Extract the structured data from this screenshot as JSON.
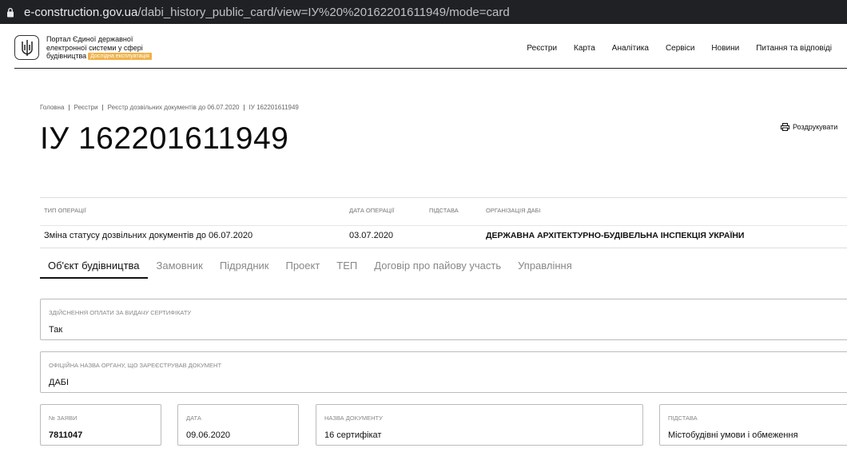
{
  "browser": {
    "url_host": "e-construction.gov.ua",
    "url_path": "/dabi_history_public_card/view=ІУ%20%20162201611949/mode=card"
  },
  "header": {
    "portal_line1": "Портал Єдиної державної",
    "portal_line2": "електронної системи у сфері",
    "portal_line3": "будівництва",
    "badge": "Дослідна експлуатація",
    "nav": [
      "Реєстри",
      "Карта",
      "Аналітика",
      "Сервіси",
      "Новини",
      "Питання та відповіді"
    ]
  },
  "breadcrumb": [
    "Головна",
    "Реєстри",
    "Реєстр дозвільних документів до 06.07.2020",
    "ІУ 162201611949"
  ],
  "title": "ІУ 162201611949",
  "print_label": "Роздрукувати",
  "operation": {
    "headers": {
      "type": "ТИП ОПЕРАЦІЇ",
      "date": "ДАТА ОПЕРАЦІЇ",
      "basis": "ПІДСТАВА",
      "org": "ОРГАНІЗАЦІЯ ДАБІ"
    },
    "values": {
      "type": "Зміна статусу дозвільних документів до 06.07.2020",
      "date": "03.07.2020",
      "basis": "",
      "org": "ДЕРЖАВНА АРХІТЕКТУРНО-БУДІВЕЛЬНА ІНСПЕКЦІЯ УКРАЇНИ"
    }
  },
  "tabs": [
    "Об'єкт будівництва",
    "Замовник",
    "Підрядник",
    "Проект",
    "ТЕП",
    "Договір про пайову участь",
    "Управління"
  ],
  "fields": {
    "payment": {
      "label": "ЗДІЙСНЕННЯ ОПЛАТИ ЗА ВИДАЧУ СЕРТИФІКАТУ",
      "value": "Так"
    },
    "authority": {
      "label": "ОФІЦІЙНА НАЗВА ОРГАНУ, ЩО ЗАРЕЄСТРУВАВ ДОКУМЕНТ",
      "value": "ДАБІ"
    },
    "app_no": {
      "label": "№ ЗАЯВИ",
      "value": "7811047"
    },
    "date": {
      "label": "ДАТА",
      "value": "09.06.2020"
    },
    "doc_name": {
      "label": "НАЗВА ДОКУМЕНТУ",
      "value": "16 сертифікат"
    },
    "basis": {
      "label": "ПІДСТАВА",
      "value": "Містобудівні умови і обмеження"
    }
  }
}
